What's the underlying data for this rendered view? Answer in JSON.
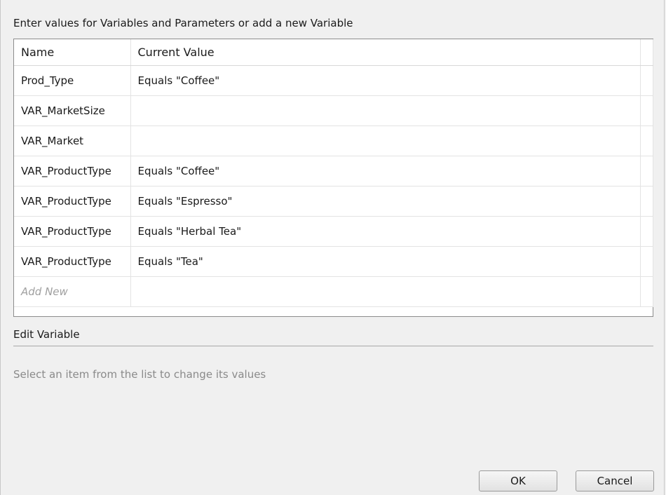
{
  "dialog": {
    "instruction": "Enter values for Variables and Parameters or add a new Variable",
    "columns": [
      "Name",
      "Current Value"
    ],
    "rows": [
      {
        "name": "Prod_Type",
        "value": "Equals \"Coffee\""
      },
      {
        "name": "VAR_MarketSize",
        "value": ""
      },
      {
        "name": "VAR_Market",
        "value": ""
      },
      {
        "name": "VAR_ProductType",
        "value": "Equals \"Coffee\""
      },
      {
        "name": "VAR_ProductType",
        "value": "Equals \"Espresso\""
      },
      {
        "name": "VAR_ProductType",
        "value": "Equals \"Herbal Tea\""
      },
      {
        "name": "VAR_ProductType",
        "value": "Equals \"Tea\""
      }
    ],
    "add_new_label": "Add New",
    "edit_section": {
      "title": "Edit Variable",
      "hint": "Select an item from the list to change its values"
    },
    "buttons": {
      "ok": "OK",
      "cancel": "Cancel"
    }
  }
}
